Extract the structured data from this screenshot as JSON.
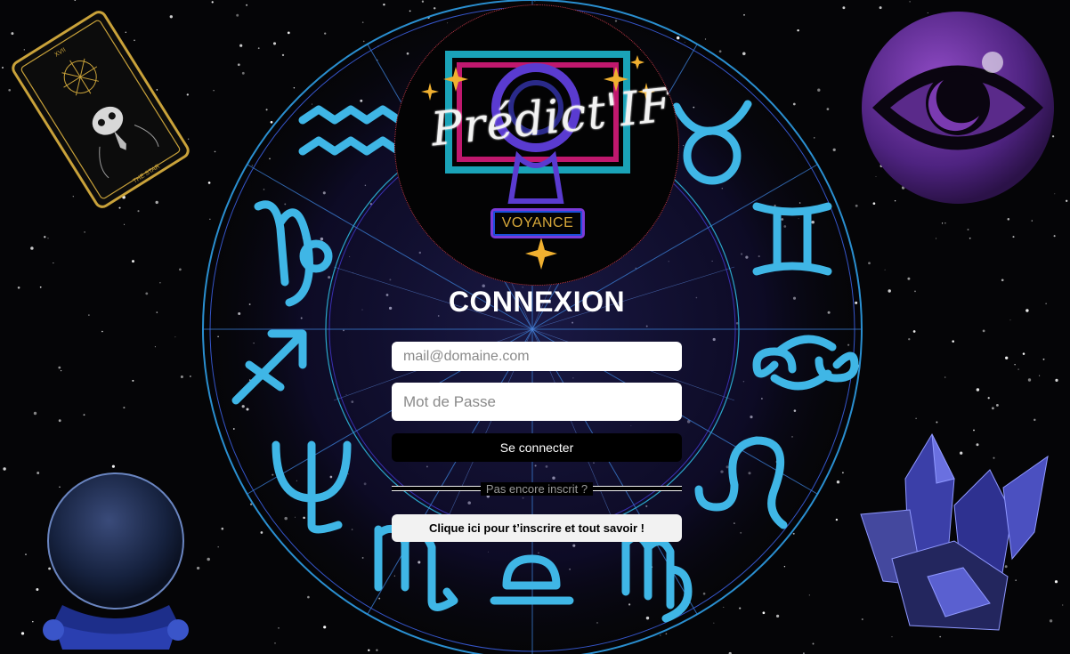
{
  "logo": {
    "brand": "Prédict'IF",
    "badge": "VOYANCE"
  },
  "form": {
    "title": "CONNEXION",
    "email_placeholder": "mail@domaine.com",
    "password_placeholder": "Mot de Passe",
    "login_label": "Se connecter",
    "divider_label": "Pas encore inscrit ?",
    "signup_label": "Clique ici pour t’inscrire et tout savoir !"
  },
  "tarot_card": {
    "numeral": "XVII",
    "name": "THE STAR"
  },
  "colors": {
    "background": "#050507",
    "zodiac_glyph": "#3fb6e6",
    "wheel_line": "#2a8fd0",
    "eye_purple": "#5a2a8a",
    "crystal": "#3b3fa8",
    "tarot_gold": "#c9a23a"
  },
  "icons": [
    "tarot-card-icon",
    "crystal-ball-icon",
    "evil-eye-icon",
    "crystal-cluster-icon",
    "zodiac-wheel-icon"
  ]
}
